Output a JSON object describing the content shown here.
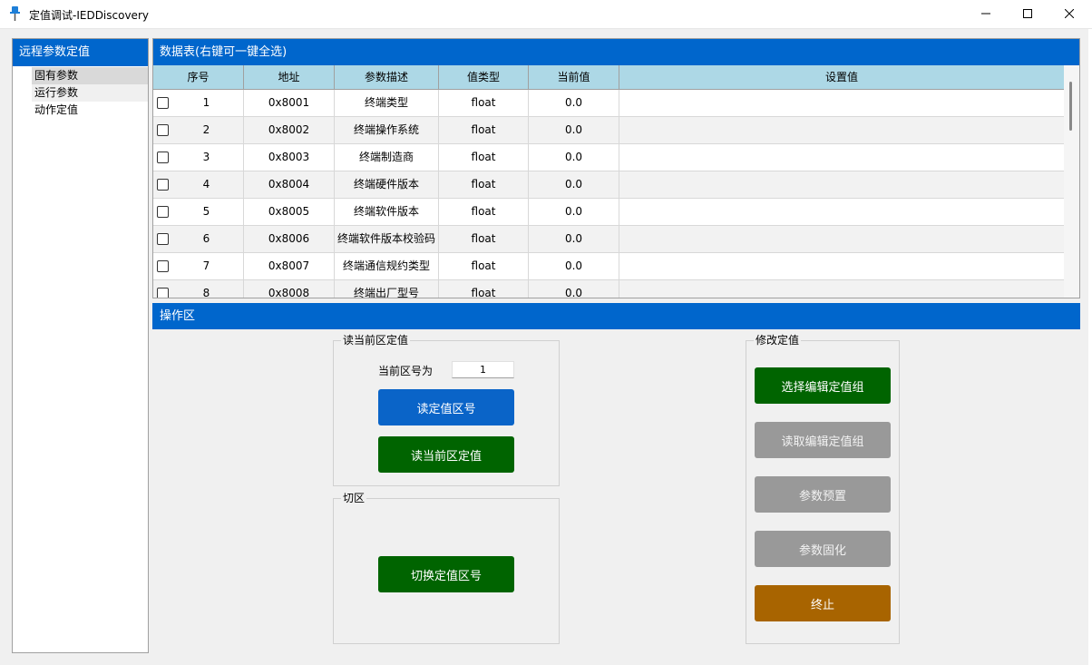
{
  "window": {
    "title": "定值调试-IEDDiscovery",
    "icon": "pushpin-icon",
    "controls": [
      "minimize-icon",
      "maximize-icon",
      "close-icon"
    ]
  },
  "sidebar": {
    "header": "远程参数定值",
    "items": [
      {
        "label": "固有参数",
        "selected": true
      },
      {
        "label": "运行参数",
        "selected": false
      },
      {
        "label": "动作定值",
        "selected": false
      }
    ]
  },
  "data_table": {
    "header": "数据表(右键可一键全选)",
    "columns": [
      "序号",
      "地址",
      "参数描述",
      "值类型",
      "当前值",
      "设置值"
    ],
    "rows": [
      {
        "seq": "1",
        "addr": "0x8001",
        "desc": "终端类型",
        "type": "float",
        "current": "0.0",
        "setting": ""
      },
      {
        "seq": "2",
        "addr": "0x8002",
        "desc": "终端操作系统",
        "type": "float",
        "current": "0.0",
        "setting": ""
      },
      {
        "seq": "3",
        "addr": "0x8003",
        "desc": "终端制造商",
        "type": "float",
        "current": "0.0",
        "setting": ""
      },
      {
        "seq": "4",
        "addr": "0x8004",
        "desc": "终端硬件版本",
        "type": "float",
        "current": "0.0",
        "setting": ""
      },
      {
        "seq": "5",
        "addr": "0x8005",
        "desc": "终端软件版本",
        "type": "float",
        "current": "0.0",
        "setting": ""
      },
      {
        "seq": "6",
        "addr": "0x8006",
        "desc": "终端软件版本校验码",
        "type": "float",
        "current": "0.0",
        "setting": ""
      },
      {
        "seq": "7",
        "addr": "0x8007",
        "desc": "终端通信规约类型",
        "type": "float",
        "current": "0.0",
        "setting": ""
      },
      {
        "seq": "8",
        "addr": "0x8008",
        "desc": "终端出厂型号",
        "type": "float",
        "current": "0.0",
        "setting": ""
      }
    ]
  },
  "operation": {
    "header": "操作区",
    "read_group": {
      "legend": "读当前区定值",
      "zone_label": "当前区号为",
      "zone_value": "1",
      "read_zone_button": "读定值区号",
      "read_values_button": "读当前区定值"
    },
    "switch_group": {
      "legend": "切区",
      "switch_button": "切换定值区号"
    },
    "modify_group": {
      "legend": "修改定值",
      "select_edit_button": "选择编辑定值组",
      "read_edit_button": "读取编辑定值组",
      "preset_button": "参数预置",
      "solidify_button": "参数固化",
      "abort_button": "终止"
    }
  },
  "colors": {
    "header_blue": "#0066cc",
    "table_header": "#add8e6",
    "button_blue": "#0a64c8",
    "button_green": "#006400",
    "button_gray": "#999999",
    "button_orange": "#a86400"
  }
}
